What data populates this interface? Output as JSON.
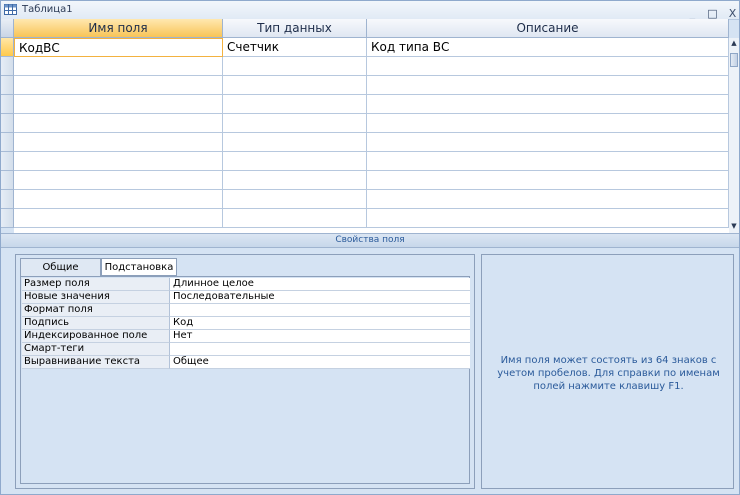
{
  "window": {
    "title": "Таблица1",
    "icons": {
      "table": "table-icon"
    },
    "controls": {
      "minimize": "_",
      "maximize": "□",
      "close": "X"
    }
  },
  "grid": {
    "columns": [
      "Имя поля",
      "Тип данных",
      "Описание"
    ],
    "rows": [
      {
        "name": "КодВС",
        "type": "Счетчик",
        "description": "Код типа ВС"
      },
      {
        "name": "",
        "type": "",
        "description": ""
      },
      {
        "name": "",
        "type": "",
        "description": ""
      },
      {
        "name": "",
        "type": "",
        "description": ""
      },
      {
        "name": "",
        "type": "",
        "description": ""
      },
      {
        "name": "",
        "type": "",
        "description": ""
      },
      {
        "name": "",
        "type": "",
        "description": ""
      },
      {
        "name": "",
        "type": "",
        "description": ""
      },
      {
        "name": "",
        "type": "",
        "description": ""
      },
      {
        "name": "",
        "type": "",
        "description": ""
      }
    ]
  },
  "properties": {
    "band_label": "Свойства поля",
    "tabs": [
      "Общие",
      "Подстановка"
    ],
    "items": [
      {
        "label": "Размер поля",
        "value": "Длинное целое"
      },
      {
        "label": "Новые значения",
        "value": "Последовательные"
      },
      {
        "label": "Формат поля",
        "value": ""
      },
      {
        "label": "Подпись",
        "value": "Код"
      },
      {
        "label": "Индексированное поле",
        "value": "Нет"
      },
      {
        "label": "Смарт-теги",
        "value": ""
      },
      {
        "label": "Выравнивание текста",
        "value": "Общее"
      }
    ],
    "hint": "Имя поля может состоять из 64 знаков с учетом пробелов.  Для справки по именам полей нажмите клавишу F1."
  },
  "colors": {
    "accent": "#f8c457",
    "panel": "#d5e3f3",
    "hint_text": "#2a5a9a"
  }
}
